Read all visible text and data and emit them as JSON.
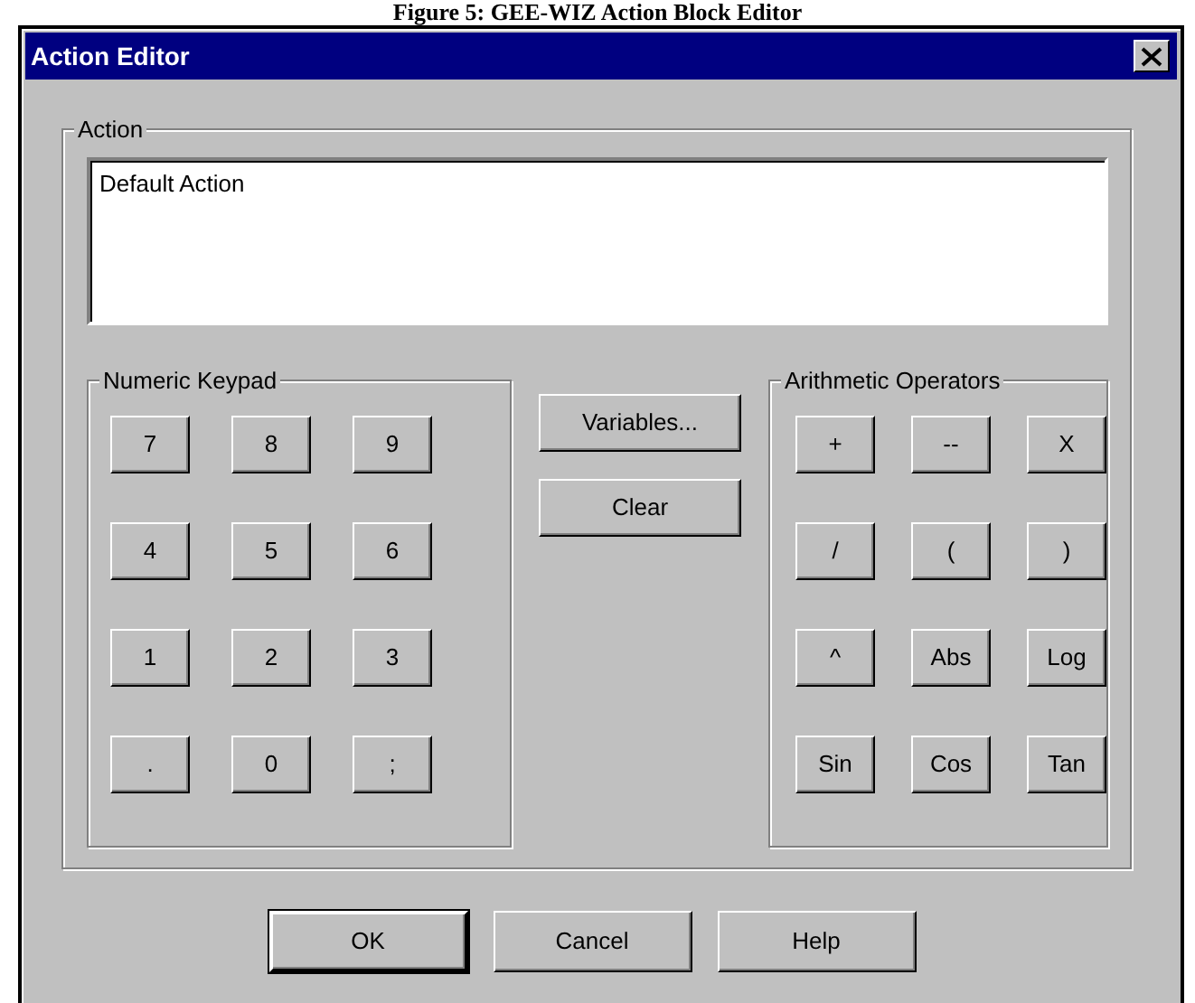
{
  "caption": "Figure 5: GEE-WIZ Action Block Editor",
  "window": {
    "title": "Action Editor"
  },
  "action": {
    "label": "Action",
    "value": "Default Action"
  },
  "numeric_keypad": {
    "label": "Numeric Keypad",
    "keys": [
      {
        "label": "7"
      },
      {
        "label": "8"
      },
      {
        "label": "9"
      },
      {
        "label": "4"
      },
      {
        "label": "5"
      },
      {
        "label": "6"
      },
      {
        "label": "1"
      },
      {
        "label": "2"
      },
      {
        "label": "3"
      },
      {
        "label": "."
      },
      {
        "label": "0"
      },
      {
        "label": ";"
      }
    ]
  },
  "middle_buttons": [
    {
      "label": "Variables..."
    },
    {
      "label": "Clear"
    }
  ],
  "arithmetic_operators": {
    "label": "Arithmetic Operators",
    "keys": [
      {
        "label": "+"
      },
      {
        "label": "--"
      },
      {
        "label": "X"
      },
      {
        "label": "/"
      },
      {
        "label": "("
      },
      {
        "label": ")"
      },
      {
        "label": "^"
      },
      {
        "label": "Abs"
      },
      {
        "label": "Log"
      },
      {
        "label": "Sin"
      },
      {
        "label": "Cos"
      },
      {
        "label": "Tan"
      }
    ]
  },
  "buttons": [
    {
      "label": "OK",
      "default": true
    },
    {
      "label": "Cancel",
      "default": false
    },
    {
      "label": "Help",
      "default": false
    }
  ]
}
